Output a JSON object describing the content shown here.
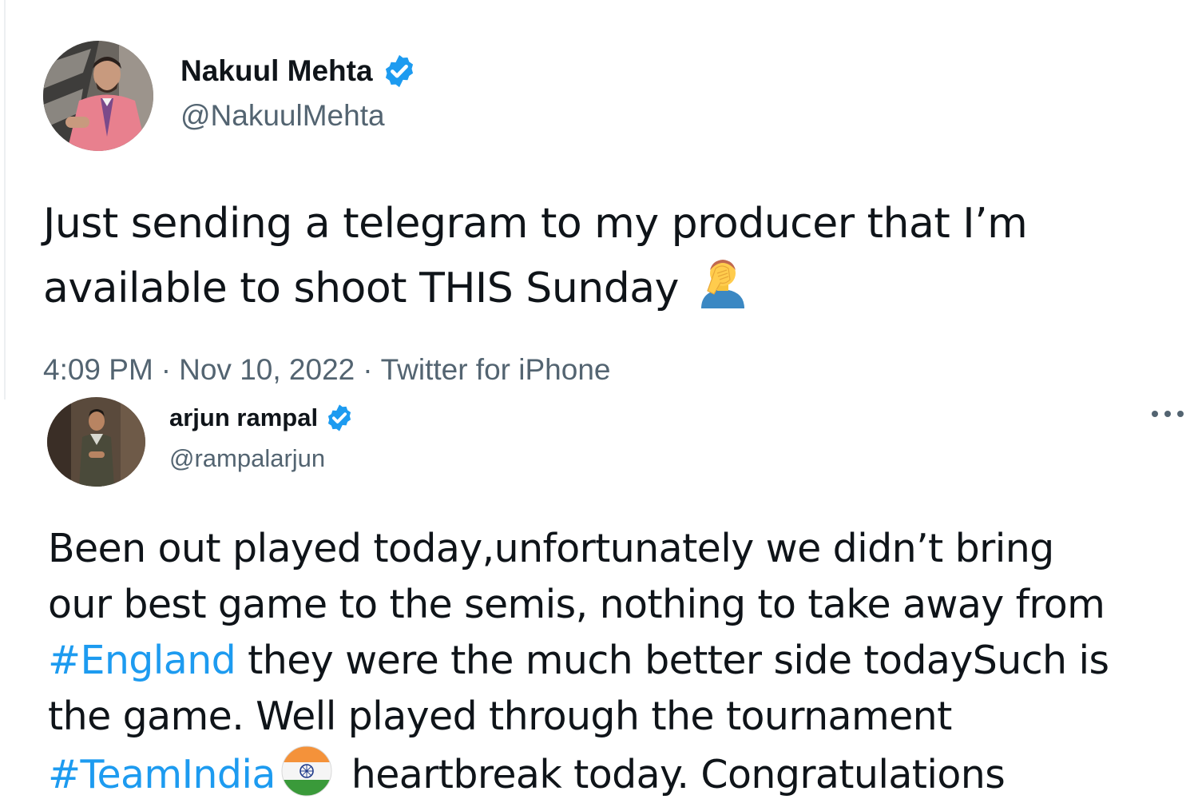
{
  "tweets": [
    {
      "display_name": "Nakuul Mehta",
      "handle": "@NakuulMehta",
      "verified": true,
      "avatar_icon": "profile-photo-man-pink-suit",
      "body_lines": [
        "Just sending a telegram to my producer that I’m",
        "available to shoot THIS Sunday"
      ],
      "emoji": "man-facepalming-emoji",
      "time": "4:09 PM",
      "date": "Nov 10, 2022",
      "source": "Twitter for iPhone",
      "separator": "·"
    },
    {
      "display_name": "arjun rampal",
      "handle": "@rampalarjun",
      "verified": true,
      "avatar_icon": "profile-photo-man-standing",
      "more_icon": "more-options-icon",
      "body": {
        "line1": "Been out played today,unfortunately we didn’t bring",
        "line2": "our best game to the semis, nothing to take away from",
        "line3_hashtag": "#England",
        "line3_text": " they were the much better side todaySuch is",
        "line4": "the game. Well played through the tournament",
        "line5_hashtag": "#TeamIndia",
        "line5_text": " heartbreak today. Congratulations"
      },
      "emoji": "india-flag-circle-emoji"
    }
  ],
  "colors": {
    "link": "#1d9bf0",
    "secondary_text": "#536471",
    "primary_text": "#0f1419",
    "verified_badge": "#1d9bf0"
  }
}
